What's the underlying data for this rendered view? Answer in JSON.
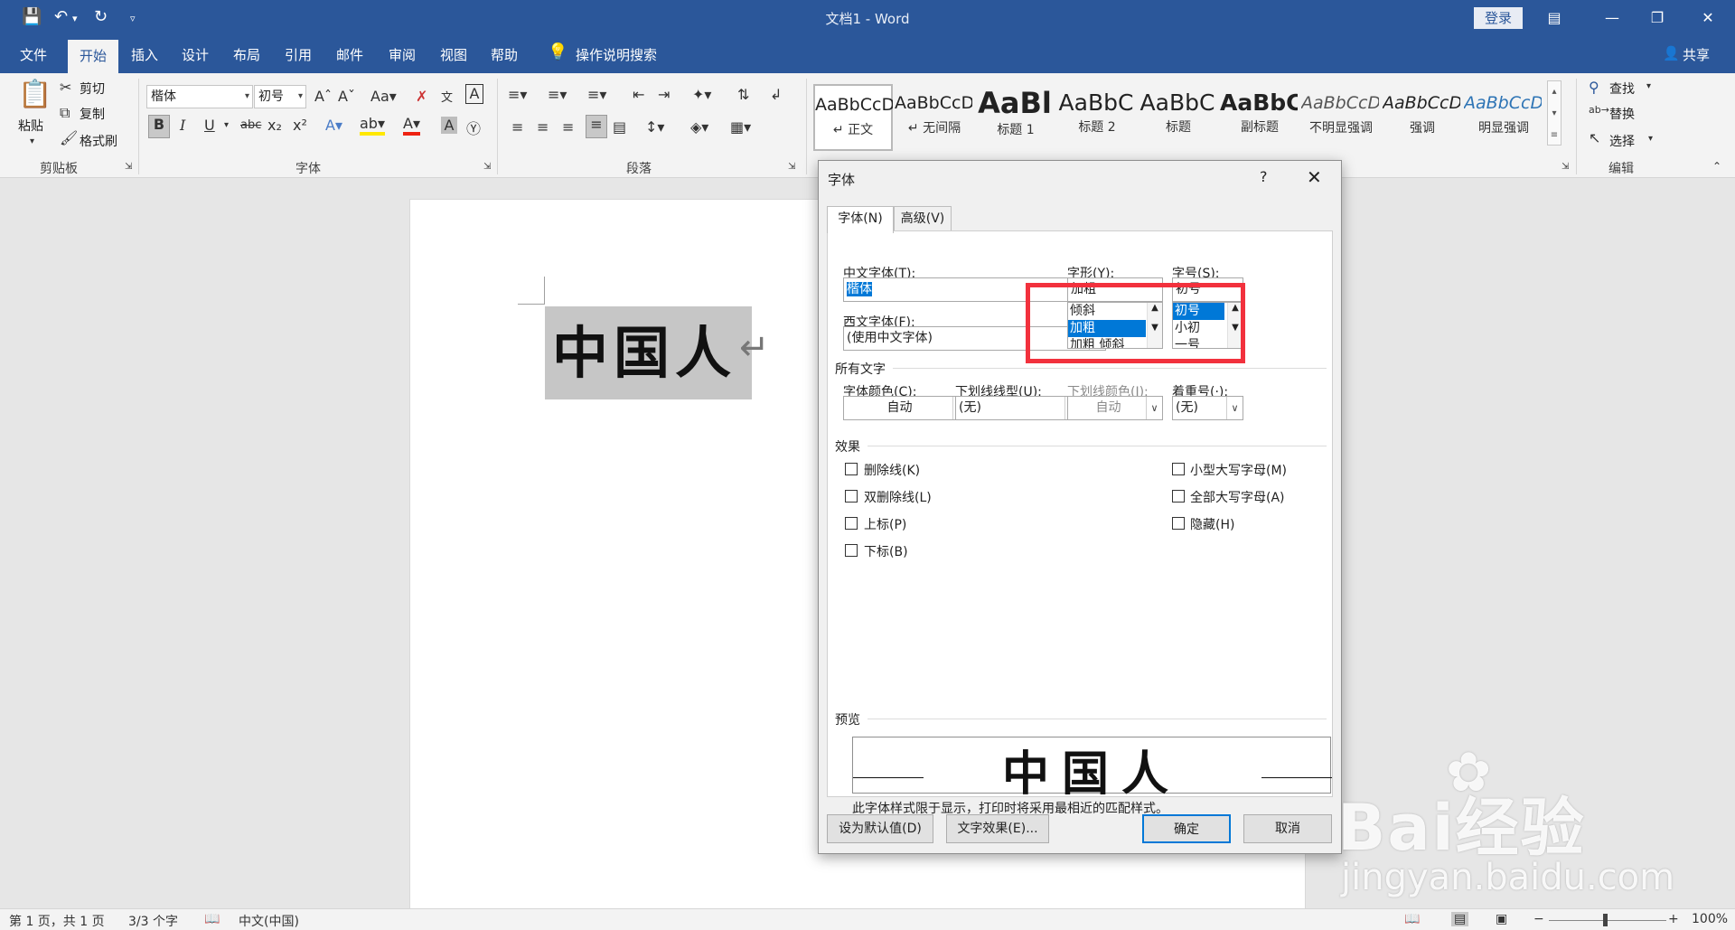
{
  "titlebar": {
    "title": "文档1 - Word",
    "login": "登录",
    "quick_save": "save-icon",
    "quick_undo": "undo-icon",
    "quick_redo": "redo-icon"
  },
  "menu": {
    "tabs": [
      "文件",
      "开始",
      "插入",
      "设计",
      "布局",
      "引用",
      "邮件",
      "审阅",
      "视图",
      "帮助"
    ],
    "search": "操作说明搜索",
    "share": "共享"
  },
  "ribbon": {
    "clipboard": {
      "paste": "粘贴",
      "cut": "剪切",
      "copy": "复制",
      "format_painter": "格式刷",
      "label": "剪贴板"
    },
    "font": {
      "name": "楷体",
      "size": "初号",
      "label": "字体"
    },
    "paragraph": {
      "label": "段落"
    },
    "styles": [
      {
        "preview": "AaBbCcDc",
        "name": "↵ 正文"
      },
      {
        "preview": "AaBbCcDc",
        "name": "↵ 无间隔"
      },
      {
        "preview": "AaBl",
        "name": "标题 1"
      },
      {
        "preview": "AaBbC",
        "name": "标题 2"
      },
      {
        "preview": "AaBbC",
        "name": "标题"
      },
      {
        "preview": "AaBbC",
        "name": "副标题"
      },
      {
        "preview": "AaBbCcDc",
        "name": "不明显强调"
      },
      {
        "preview": "AaBbCcDc",
        "name": "强调"
      },
      {
        "preview": "AaBbCcDc",
        "name": "明显强调"
      }
    ],
    "editing": {
      "find": "查找",
      "replace": "替换",
      "select": "选择",
      "label": "编辑"
    }
  },
  "document": {
    "text": "中国人"
  },
  "dialog": {
    "title": "字体",
    "tabs": [
      "字体(N)",
      "高级(V)"
    ],
    "chinese_font_label": "中文字体(T):",
    "chinese_font_value": "楷体",
    "western_font_label": "西文字体(F):",
    "western_font_value": "(使用中文字体)",
    "style_label": "字形(Y):",
    "style_value": "加粗",
    "style_options": [
      "倾斜",
      "加粗",
      "加粗 倾斜"
    ],
    "size_label": "字号(S):",
    "size_value": "初号",
    "size_options": [
      "初号",
      "小初",
      "一号"
    ],
    "all_text_label": "所有文字",
    "color_label": "字体颜色(C):",
    "color_value": "自动",
    "underline_label": "下划线线型(U):",
    "underline_value": "(无)",
    "underline_color_label": "下划线颜色(I):",
    "underline_color_value": "自动",
    "emphasis_label": "着重号(·):",
    "emphasis_value": "(无)",
    "effects_label": "效果",
    "effects_left": [
      "删除线(K)",
      "双删除线(L)",
      "上标(P)",
      "下标(B)"
    ],
    "effects_right": [
      "小型大写字母(M)",
      "全部大写字母(A)",
      "隐藏(H)"
    ],
    "preview_label": "预览",
    "preview_text": "中国人",
    "preview_note": "此字体样式限于显示，打印时将采用最相近的匹配样式。",
    "btn_default": "设为默认值(D)",
    "btn_effects": "文字效果(E)...",
    "btn_ok": "确定",
    "btn_cancel": "取消"
  },
  "status": {
    "page": "第 1 页，共 1 页",
    "words": "3/3 个字",
    "lang": "中文(中国)",
    "zoom": "100%"
  },
  "watermark": {
    "logo": "Bai经验",
    "url": "jingyan.baidu.com"
  }
}
